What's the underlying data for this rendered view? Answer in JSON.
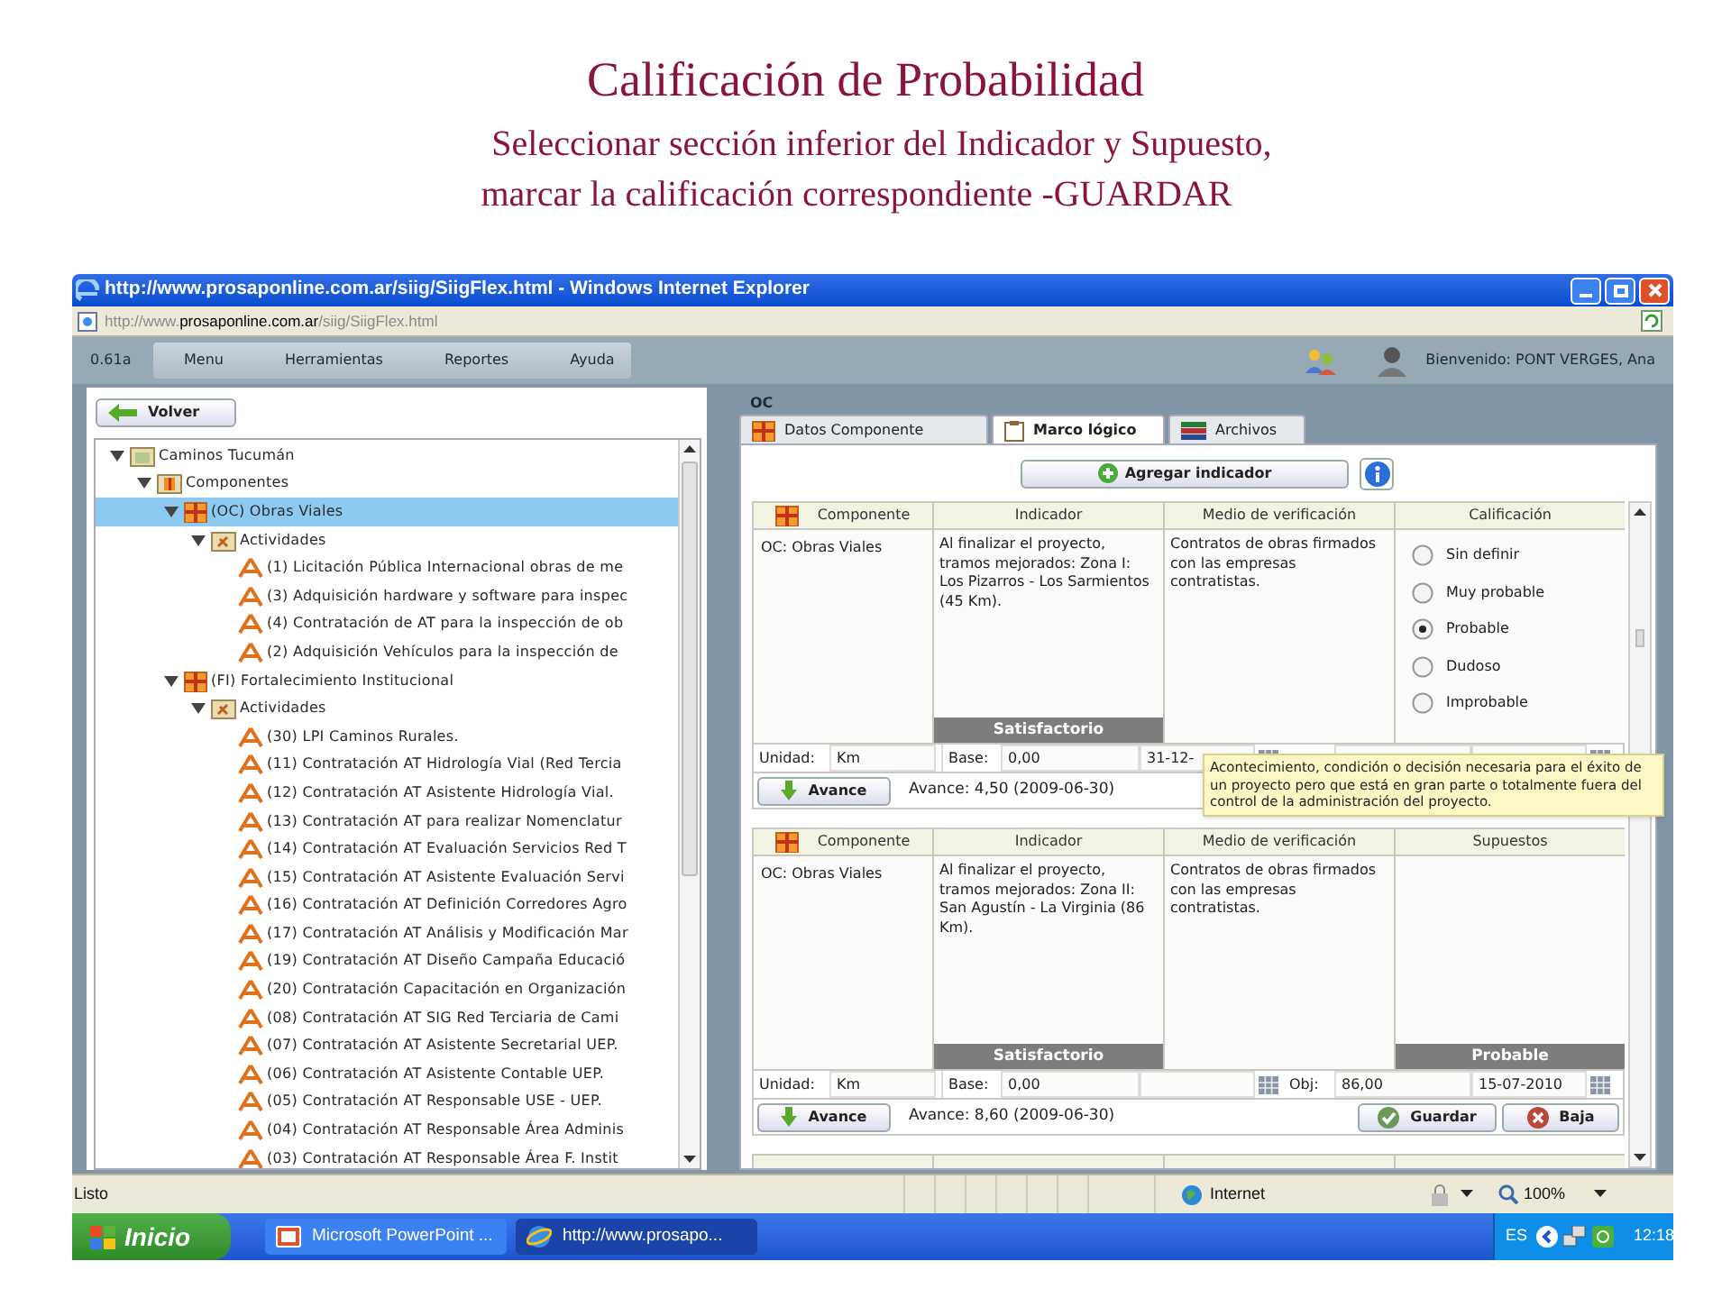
{
  "slide": {
    "title": "Calificación de Probabilidad",
    "subtitle_lines": [
      "Seleccionar sección inferior del Indicador y Supuesto,",
      "marcar la calificación correspondiente -GUARDAR"
    ]
  },
  "browser": {
    "title": "http://www.prosaponline.com.ar/siig/SiigFlex.html - Windows Internet Explorer",
    "address": "http://www.**prosaponline.com.ar**/siig/SiigFlex.html"
  },
  "app": {
    "version": "0.61a",
    "menu": [
      "Menu",
      "Herramientas",
      "Reportes",
      "Ayuda"
    ],
    "welcome": "Bienvenido: PONT VERGES, Ana"
  },
  "left_panel": {
    "back_button": "Volver",
    "tree": [
      {
        "kind": "project",
        "label": "Caminos Tucumán",
        "expanded": true,
        "selected": false,
        "children": [
          {
            "kind": "group",
            "label": "Componentes",
            "expanded": true,
            "selected": false,
            "children": [
              {
                "kind": "component",
                "label": "(OC) Obras Viales",
                "expanded": true,
                "selected": true,
                "children": [
                  {
                    "kind": "folder",
                    "label": "Actividades",
                    "expanded": true,
                    "selected": false,
                    "children": [
                      {
                        "kind": "activity",
                        "label": "(1) Licitación Pública Internacional obras de me",
                        "selected": false
                      },
                      {
                        "kind": "activity",
                        "label": "(3) Adquisición hardware y software para inspec",
                        "selected": false
                      },
                      {
                        "kind": "activity",
                        "label": "(4) Contratación de AT para la inspección de ob",
                        "selected": false
                      },
                      {
                        "kind": "activity",
                        "label": "(2) Adquisición Vehículos para la inspección de",
                        "selected": false
                      }
                    ]
                  }
                ]
              },
              {
                "kind": "component",
                "label": "(FI) Fortalecimiento Institucional",
                "expanded": true,
                "selected": false,
                "children": [
                  {
                    "kind": "folder",
                    "label": "Actividades",
                    "expanded": true,
                    "selected": false,
                    "children": [
                      {
                        "kind": "activity",
                        "label": "(30) LPI Caminos Rurales.",
                        "selected": false
                      },
                      {
                        "kind": "activity",
                        "label": "(11) Contratación AT Hidrología Vial (Red Tercia",
                        "selected": false
                      },
                      {
                        "kind": "activity",
                        "label": "(12) Contratación AT Asistente Hidrología Vial.",
                        "selected": false
                      },
                      {
                        "kind": "activity",
                        "label": "(13) Contratación AT para realizar Nomenclatur",
                        "selected": false
                      },
                      {
                        "kind": "activity",
                        "label": "(14) Contratación AT Evaluación Servicios Red T",
                        "selected": false
                      },
                      {
                        "kind": "activity",
                        "label": "(15) Contratación AT Asistente Evaluación Servi",
                        "selected": false
                      },
                      {
                        "kind": "activity",
                        "label": "(16) Contratación AT Definición Corredores Agro",
                        "selected": false
                      },
                      {
                        "kind": "activity",
                        "label": "(17) Contratación AT Análisis y Modificación Mar",
                        "selected": false
                      },
                      {
                        "kind": "activity",
                        "label": "(19) Contratación AT Diseño Campaña Educació",
                        "selected": false
                      },
                      {
                        "kind": "activity",
                        "label": "(20) Contratación Capacitación en Organización",
                        "selected": false
                      },
                      {
                        "kind": "activity",
                        "label": "(08) Contratación AT SIG Red Terciaria de Cami",
                        "selected": false
                      },
                      {
                        "kind": "activity",
                        "label": "(07) Contratación AT Asistente Secretarial UEP.",
                        "selected": false
                      },
                      {
                        "kind": "activity",
                        "label": "(06) Contratación AT Asistente Contable UEP.",
                        "selected": false
                      },
                      {
                        "kind": "activity",
                        "label": "(05) Contratación AT Responsable USE - UEP.",
                        "selected": false
                      },
                      {
                        "kind": "activity",
                        "label": "(04) Contratación AT Responsable Área Adminis",
                        "selected": false
                      },
                      {
                        "kind": "activity",
                        "label": "(03) Contratación AT Responsable Área F. Instit",
                        "selected": false
                      }
                    ]
                  }
                ]
              }
            ]
          }
        ]
      }
    ]
  },
  "right_panel": {
    "section": "OC",
    "tabs": [
      {
        "label": "Datos Componente",
        "selected": false
      },
      {
        "label": "Marco lógico",
        "selected": true
      },
      {
        "label": "Archivos",
        "selected": false
      }
    ],
    "add_button": "Agregar indicador",
    "cards": [
      {
        "kind": "rating",
        "columns": [
          "Componente",
          "Indicador",
          "Medio de verificación",
          "Calificación"
        ],
        "component": "OC: Obras Viales",
        "indicator": "Al finalizar el proyecto, tramos mejorados: Zona I: Los Pizarros - Los Sarmientos (45 Km).",
        "indicator_status": "Satisfactorio",
        "verification": "Contratos de obras firmados con las empresas contratistas.",
        "options": [
          {
            "label": "Sin definir",
            "selected": false
          },
          {
            "label": "Muy probable",
            "selected": false
          },
          {
            "label": "Probable",
            "selected": true
          },
          {
            "label": "Dudoso",
            "selected": false
          },
          {
            "label": "Improbable",
            "selected": false
          }
        ],
        "unit_label": "Unidad:",
        "unit": "Km",
        "base_label": "Base:",
        "base": "0,00",
        "base_date": "31-12-",
        "progress_button": "Avance",
        "progress": "Avance: 4,50 (2009-06-30)"
      },
      {
        "kind": "assumption",
        "columns": [
          "Componente",
          "Indicador",
          "Medio de verificación",
          "Supuestos"
        ],
        "component": "OC: Obras Viales",
        "indicator": "Al finalizar el proyecto, tramos mejorados: Zona II: San Agustín - La Virginia (86 Km).",
        "indicator_status": "Satisfactorio",
        "verification": "Contratos de obras firmados con las empresas contratistas.",
        "assumption_status": "Probable",
        "unit_label": "Unidad:",
        "unit": "Km",
        "base_label": "Base:",
        "base": "0,00",
        "obj_label": "Obj:",
        "obj": "86,00",
        "obj_date": "15-07-2010",
        "progress_button": "Avance",
        "progress": "Avance: 8,60 (2009-06-30)",
        "save_button": "Guardar",
        "delete_button": "Baja"
      }
    ],
    "tooltip": "Acontecimiento, condición o decisión necesaria para el éxito de un proyecto pero que está en gran parte o totalmente fuera del control de la administración del proyecto."
  },
  "status_bar": {
    "text": "Listo",
    "zone": "Internet",
    "zoom": "100%"
  },
  "taskbar": {
    "start": "Inicio",
    "tasks": [
      {
        "label": "Microsoft PowerPoint ...",
        "selected": false
      },
      {
        "label": "http://www.prosapo...",
        "selected": true
      }
    ],
    "language": "ES",
    "clock": "12:18"
  }
}
